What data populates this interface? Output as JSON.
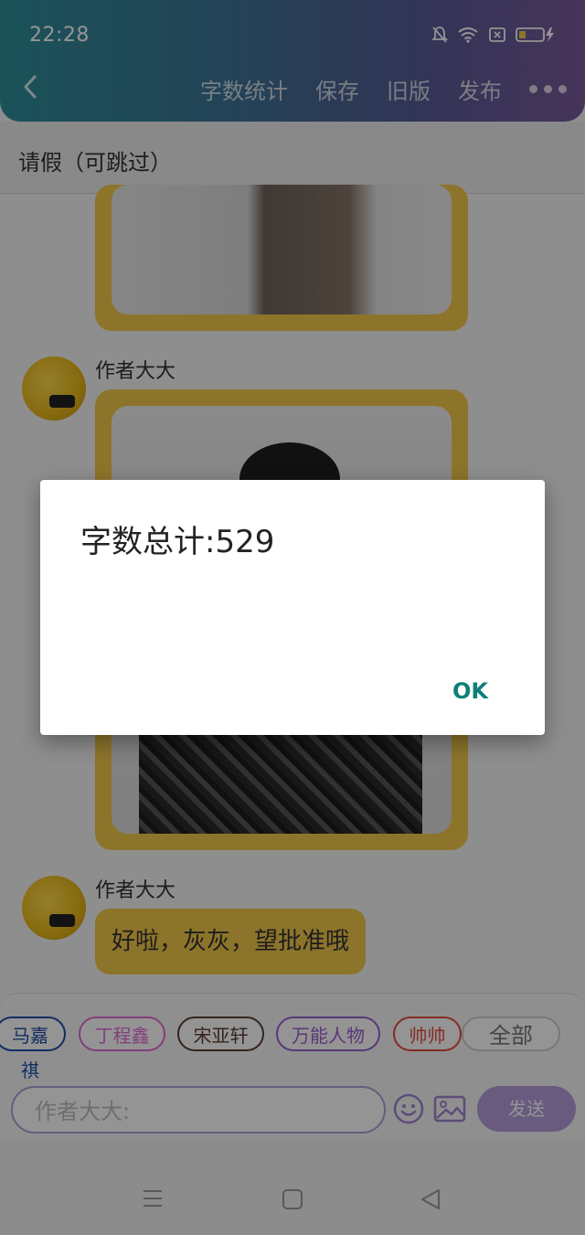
{
  "status_bar": {
    "time": "22:28"
  },
  "header": {
    "actions": [
      "字数统计",
      "保存",
      "旧版",
      "发布"
    ]
  },
  "chapter": {
    "title": "请假（可跳过）"
  },
  "messages": [
    {
      "author": "作者大大"
    },
    {
      "author": "作者大大",
      "text": "好啦，灰灰，望批准哦"
    }
  ],
  "chips": [
    {
      "label": "马嘉祺",
      "color": "#1f4fa8"
    },
    {
      "label": "丁程鑫",
      "color": "#e06bd6"
    },
    {
      "label": "宋亚轩",
      "color": "#7a5b4a"
    },
    {
      "label": "万能人物",
      "color": "#9a5fd0"
    },
    {
      "label": "帅帅",
      "color": "#e64b3c"
    },
    {
      "label": "全部",
      "color": "#9e9e9e"
    }
  ],
  "input": {
    "placeholder": "作者大大:",
    "send_label": "发送"
  },
  "dialog": {
    "message": "字数总计:529",
    "ok_label": "OK"
  },
  "colors": {
    "accent": "#b39ddb",
    "bubble": "#f3c94b",
    "ok": "#0e7f79"
  }
}
